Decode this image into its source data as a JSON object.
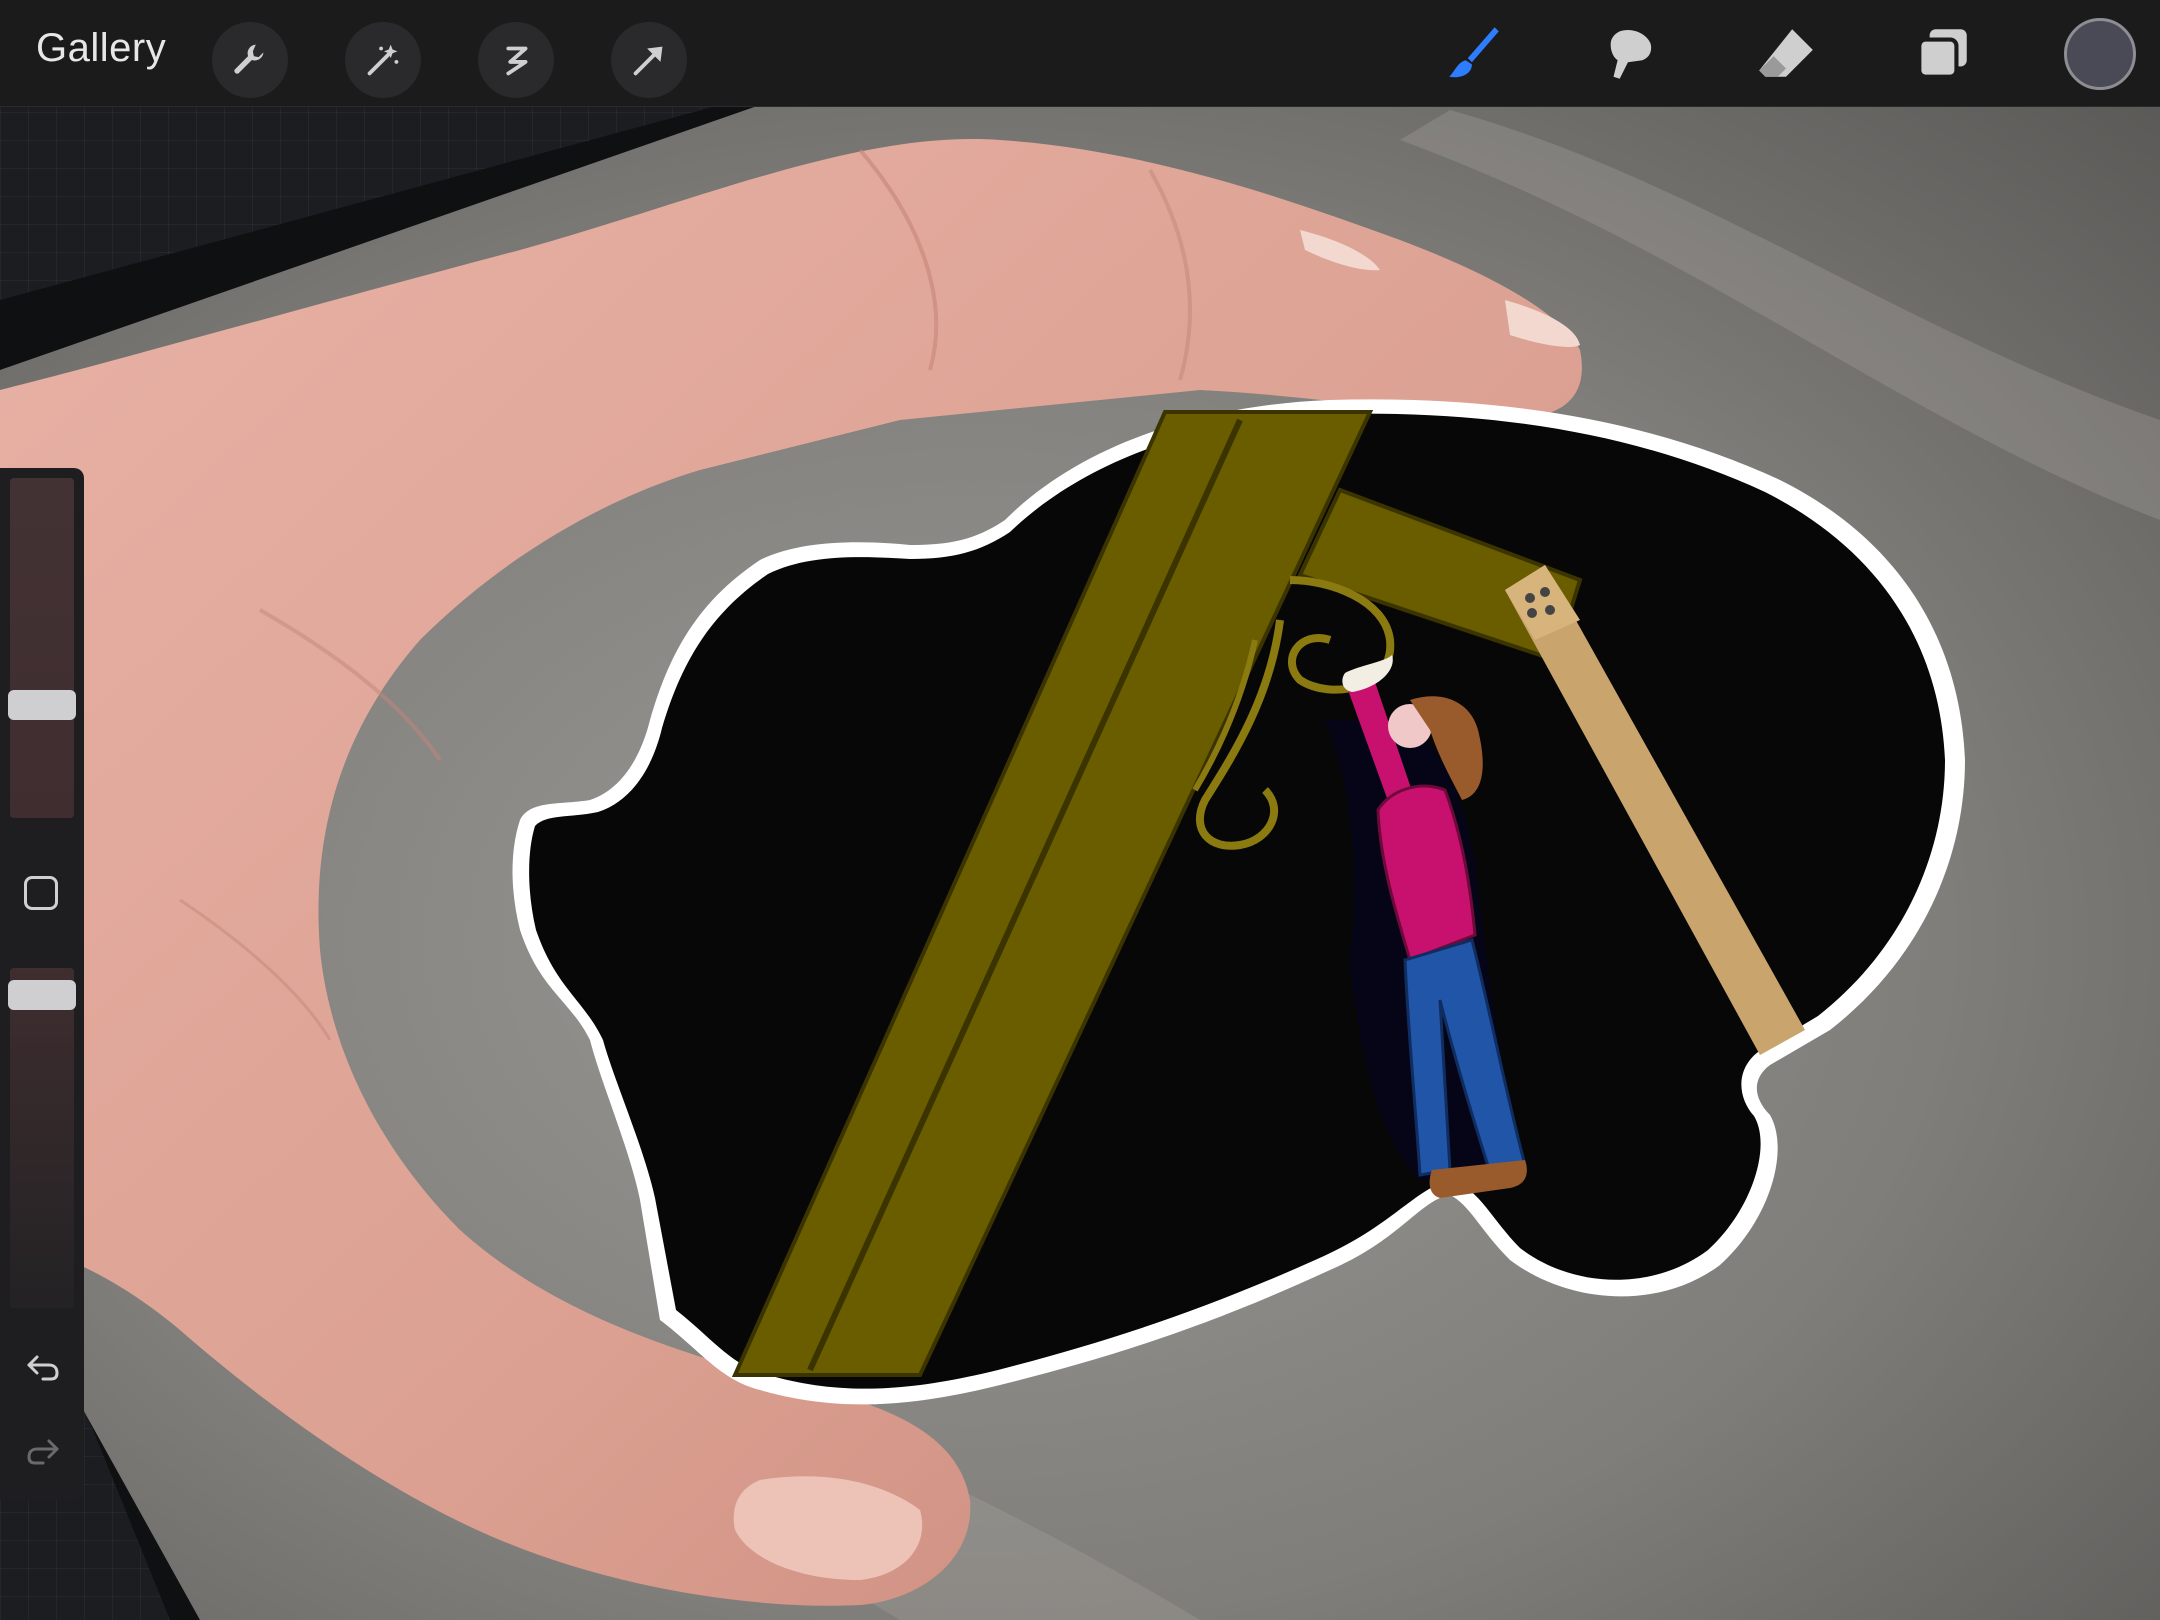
{
  "toolbar": {
    "gallery_label": "Gallery",
    "left_tools": [
      {
        "name": "actions",
        "icon": "wrench-icon"
      },
      {
        "name": "adjustments",
        "icon": "magic-wand-icon"
      },
      {
        "name": "selection",
        "icon": "selection-s-icon"
      },
      {
        "name": "transform",
        "icon": "arrow-cursor-icon"
      }
    ],
    "right_tools": [
      {
        "name": "brush",
        "icon": "brush-icon",
        "active": true
      },
      {
        "name": "smudge",
        "icon": "smudge-finger-icon",
        "active": false
      },
      {
        "name": "eraser",
        "icon": "eraser-icon",
        "active": false
      },
      {
        "name": "layers",
        "icon": "layers-icon",
        "active": false
      }
    ],
    "current_color": "#4a4a57",
    "active_color": "#2f7dff"
  },
  "sidebar": {
    "brush_size_level": 0.68,
    "brush_opacity_level": 0.95,
    "modify_icon": "square-modify-icon",
    "undo_icon": "undo-arrow-icon",
    "redo_icon": "redo-arrow-icon"
  },
  "artwork": {
    "subject": "sticker-photo",
    "colors": {
      "sticker_fill": "#070708",
      "beam_olive": "#6a5d00",
      "post_tan": "#c9a46c",
      "shirt": "#c8116e",
      "jeans": "#2155a8",
      "hair": "#9a5b2c",
      "skin": "#e2a08e"
    }
  }
}
